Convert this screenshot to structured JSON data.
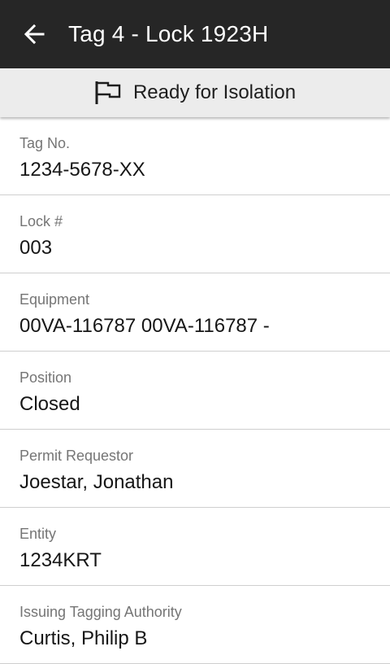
{
  "app_bar": {
    "back_icon": "arrow-left-icon",
    "title": "Tag 4 - Lock 1923H",
    "background": "#262626"
  },
  "status": {
    "icon": "flag-outline-icon",
    "text": "Ready for Isolation"
  },
  "fields": [
    {
      "label": "Tag No.",
      "value": "1234-5678-XX"
    },
    {
      "label": "Lock #",
      "value": "003"
    },
    {
      "label": "Equipment",
      "value": "00VA-116787 00VA-116787 -"
    },
    {
      "label": "Position",
      "value": "Closed"
    },
    {
      "label": "Permit Requestor",
      "value": "Joestar, Jonathan"
    },
    {
      "label": "Entity",
      "value": "1234KRT"
    },
    {
      "label": "Issuing Tagging Authority",
      "value": "Curtis, Philip B"
    }
  ]
}
